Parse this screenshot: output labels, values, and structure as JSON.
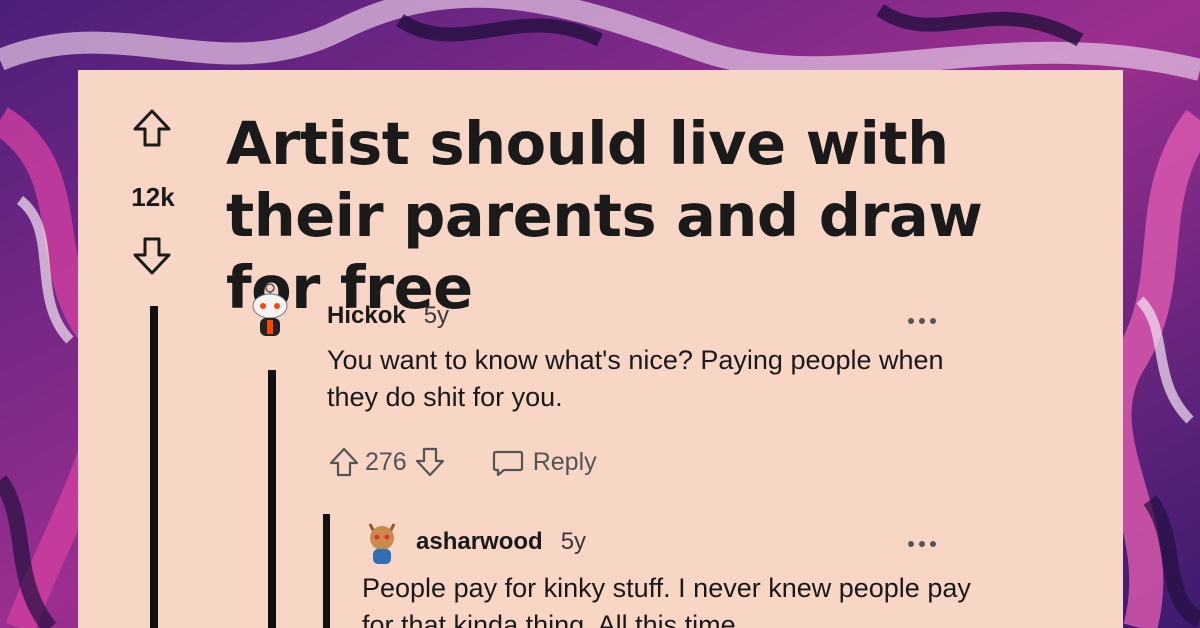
{
  "post": {
    "title": "Artist should live with their parents and draw for free",
    "score": "12k"
  },
  "comments": [
    {
      "author": "Hickok",
      "age": "5y",
      "text": "You want to know what's nice? Paying people when they do shit for you.",
      "votes": "276",
      "reply_label": "Reply"
    },
    {
      "author": "asharwood",
      "age": "5y",
      "text": "People pay for kinky stuff. I never knew people pay for that kinda thing. All this time"
    }
  ],
  "icons": {
    "upvote": "arrow-up-outline",
    "downvote": "arrow-down-outline",
    "reply": "speech-bubble",
    "more": "three-dots",
    "avatar": "reddit-snoo"
  },
  "colors": {
    "card": "#f7d6c6",
    "text": "#1a1a1b",
    "muted": "#555555",
    "background": "#6a2a86"
  }
}
